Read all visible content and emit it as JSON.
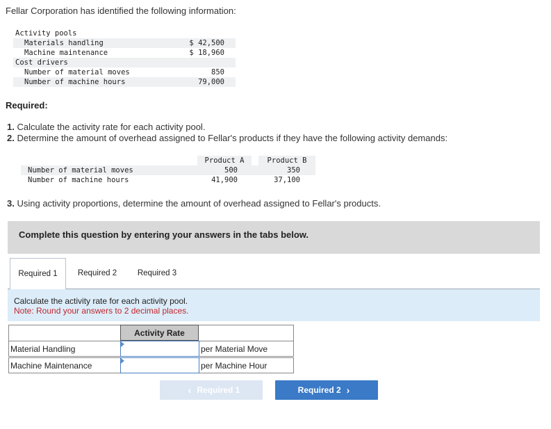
{
  "intro": "Fellar Corporation has identified the following information:",
  "info": {
    "activity_pools_label": "Activity pools",
    "materials_handling_label": "Materials handling",
    "materials_handling_value": "$ 42,500",
    "machine_maintenance_label": "Machine maintenance",
    "machine_maintenance_value": "$ 18,960",
    "cost_drivers_label": "Cost drivers",
    "material_moves_label": "Number of material moves",
    "material_moves_value": "850",
    "machine_hours_label": "Number of machine hours",
    "machine_hours_value": "79,000"
  },
  "required_heading": "Required:",
  "requirements": {
    "r1_num": "1.",
    "r1_text": "Calculate the activity rate for each activity pool.",
    "r2_num": "2.",
    "r2_text": "Determine the amount of overhead assigned to Fellar's products if they have the following activity demands:",
    "r3_num": "3.",
    "r3_text": "Using activity proportions, determine the amount of overhead assigned to Fellar's products."
  },
  "demands": {
    "col_a": "Product A",
    "col_b": "Product B",
    "rows": [
      {
        "label": "Number of material moves",
        "a": "500",
        "b": "350"
      },
      {
        "label": "Number of machine hours",
        "a": "41,900",
        "b": "37,100"
      }
    ]
  },
  "banner": "Complete this question by entering your answers in the tabs below.",
  "tabs": [
    {
      "label": "Required 1"
    },
    {
      "label": "Required 2"
    },
    {
      "label": "Required 3"
    }
  ],
  "instructions": {
    "line1": "Calculate the activity rate for each activity pool.",
    "line2": "Note: Round your answers to 2 decimal places."
  },
  "answer_table": {
    "header": "Activity Rate",
    "rows": [
      {
        "label": "Material Handling",
        "value": "",
        "unit": "per Material Move"
      },
      {
        "label": "Machine Maintenance",
        "value": "",
        "unit": "per Machine Hour"
      }
    ]
  },
  "nav": {
    "prev_label": "Required 1",
    "next_label": "Required 2"
  },
  "colors": {
    "accent": "#3a7ac7",
    "note_red": "#c0262d",
    "instr_bg": "#dcecf8",
    "banner_bg": "#d9d9d9"
  }
}
